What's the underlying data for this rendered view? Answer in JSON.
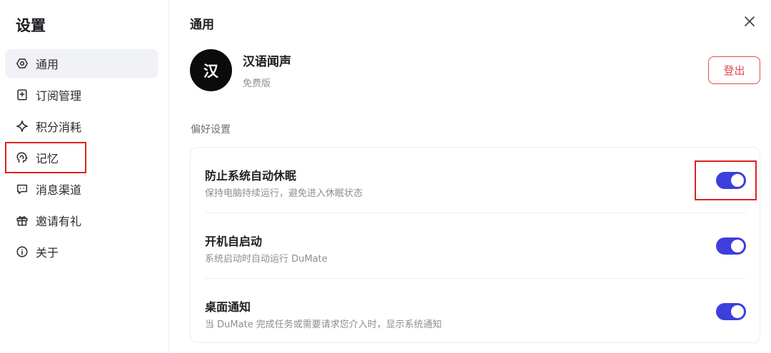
{
  "sidebar": {
    "title": "设置",
    "items": [
      {
        "label": "通用",
        "icon": "settings-hex-icon",
        "active": true
      },
      {
        "label": "订阅管理",
        "icon": "subscription-icon",
        "active": false
      },
      {
        "label": "积分消耗",
        "icon": "sparkle-icon",
        "active": false
      },
      {
        "label": "记忆",
        "icon": "memory-head-icon",
        "active": false
      },
      {
        "label": "消息渠道",
        "icon": "message-channel-icon",
        "active": false
      },
      {
        "label": "邀请有礼",
        "icon": "gift-icon",
        "active": false
      },
      {
        "label": "关于",
        "icon": "info-icon",
        "active": false
      }
    ]
  },
  "main": {
    "title": "通用",
    "profile": {
      "avatar_text": "汉",
      "name": "汉语闻声",
      "plan": "免费版"
    },
    "logout_label": "登出",
    "section_label": "偏好设置",
    "preferences": [
      {
        "title": "防止系统自动休眠",
        "description": "保持电脑持续运行，避免进入休眠状态",
        "enabled": true
      },
      {
        "title": "开机自启动",
        "description": "系统启动时自动运行 DuMate",
        "enabled": true
      },
      {
        "title": "桌面通知",
        "description": "当 DuMate 完成任务或需要请求您介入时，显示系统通知",
        "enabled": true
      }
    ]
  },
  "colors": {
    "accent": "#3d3fdc",
    "danger": "#e5484d",
    "annotation": "#e02020",
    "active_bg": "#f1f2f7"
  }
}
